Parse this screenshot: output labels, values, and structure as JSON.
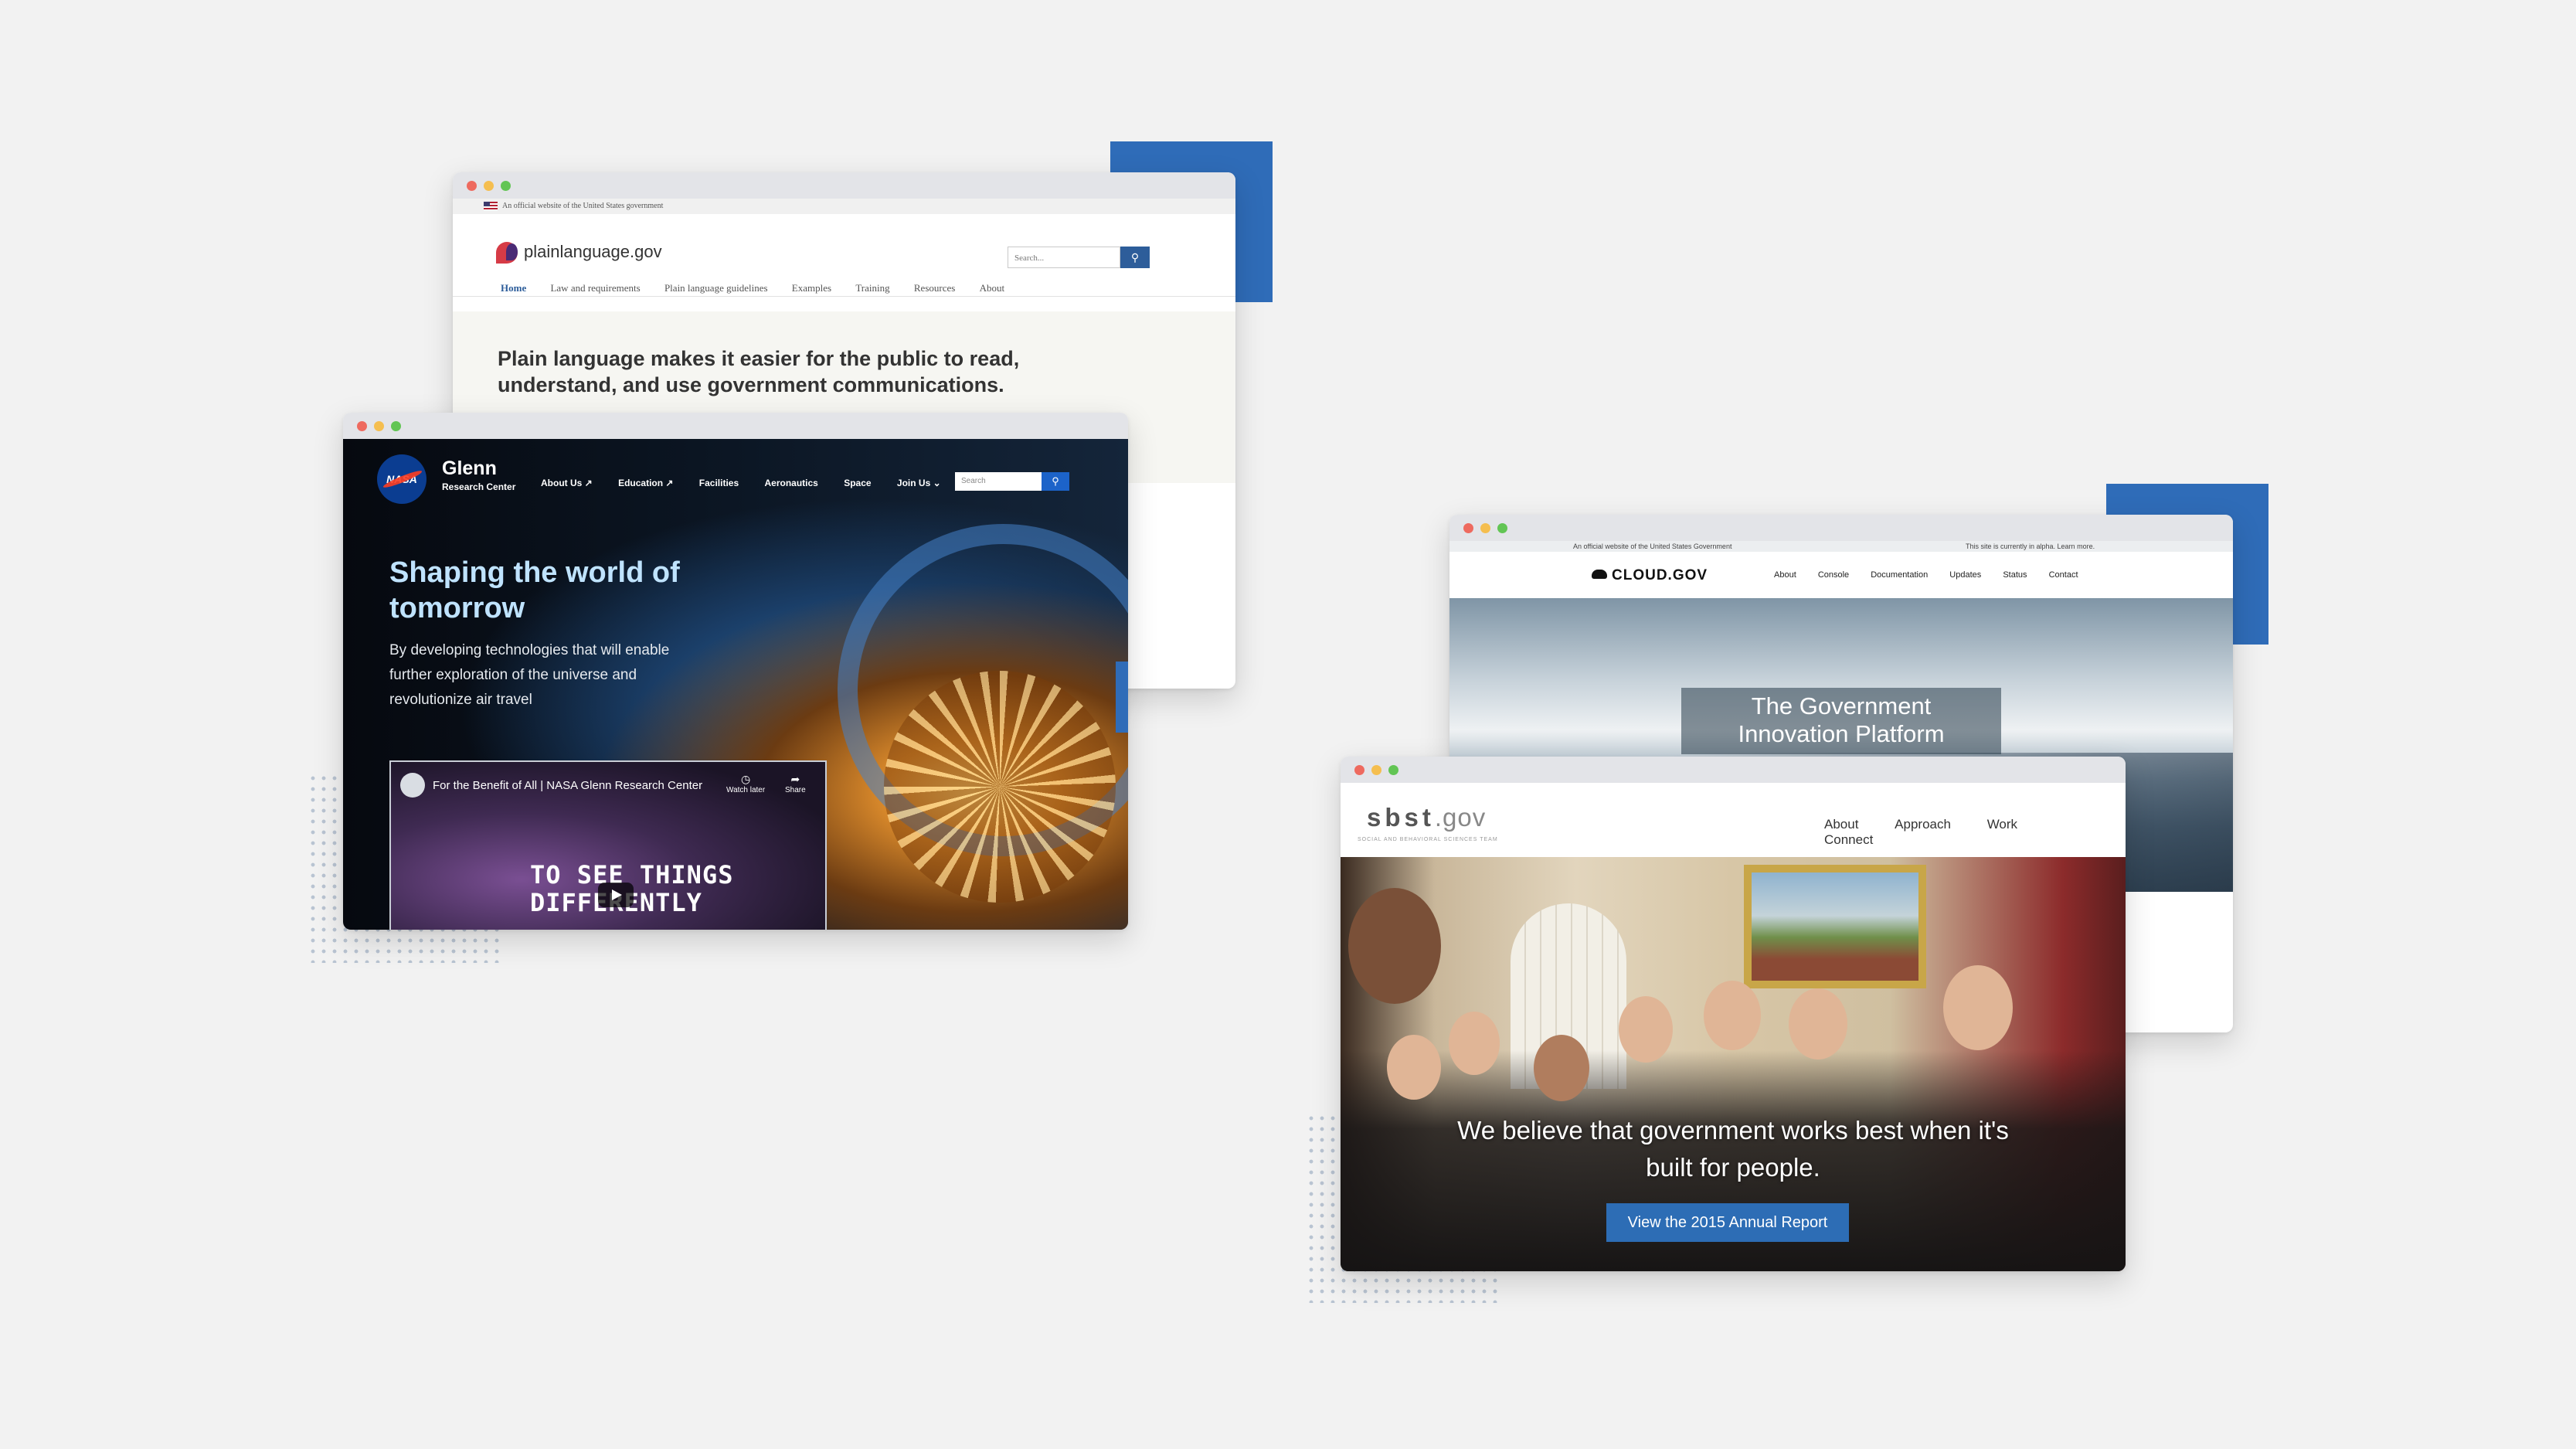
{
  "accent_color": "#2f6cb8",
  "plain": {
    "gov_banner": "An official website of the United States government",
    "logo": "plainlanguage.gov",
    "search_placeholder": "Search...",
    "search_icon": "search-icon",
    "nav": [
      "Home",
      "Law and requirements",
      "Plain language guidelines",
      "Examples",
      "Training",
      "Resources",
      "About"
    ],
    "hero": "Plain language makes it easier for the public to read, understand, and use government communications."
  },
  "nasa": {
    "logo": "NASA",
    "title": "Glenn",
    "subtitle": "Research Center",
    "nav": [
      "About Us ↗",
      "Education ↗",
      "Facilities",
      "Aeronautics",
      "Space",
      "Join Us ⌄"
    ],
    "search_placeholder": "Search",
    "headline": "Shaping the world of tomorrow",
    "sub": "By developing technologies that will enable further exploration of the universe and revolutionize air travel",
    "video_title": "For the Benefit of All | NASA Glenn Research Center",
    "watch_later": "Watch later",
    "share": "Share",
    "video_caption_1": "TO SEE THINGS",
    "video_caption_2": "DIFFERENTLY"
  },
  "cloud": {
    "gov_banner": "An official website of the United States Government",
    "alpha_banner": "This site is currently in alpha. Learn more.",
    "brand": "CLOUD.GOV",
    "nav": [
      "About",
      "Console",
      "Documentation",
      "Updates",
      "Status",
      "Contact"
    ],
    "tagline_1": "The Government",
    "tagline_2": "Innovation Platform"
  },
  "sbst": {
    "logo_main": "sbst",
    "logo_suffix": ".gov",
    "logo_tag": "SOCIAL AND BEHAVIORAL SCIENCES TEAM",
    "nav": [
      "About",
      "Approach",
      "Work",
      "Connect"
    ],
    "quote_1": "We believe that government works best when it's",
    "quote_2": "built for people.",
    "cta": "View the 2015 Annual Report"
  }
}
